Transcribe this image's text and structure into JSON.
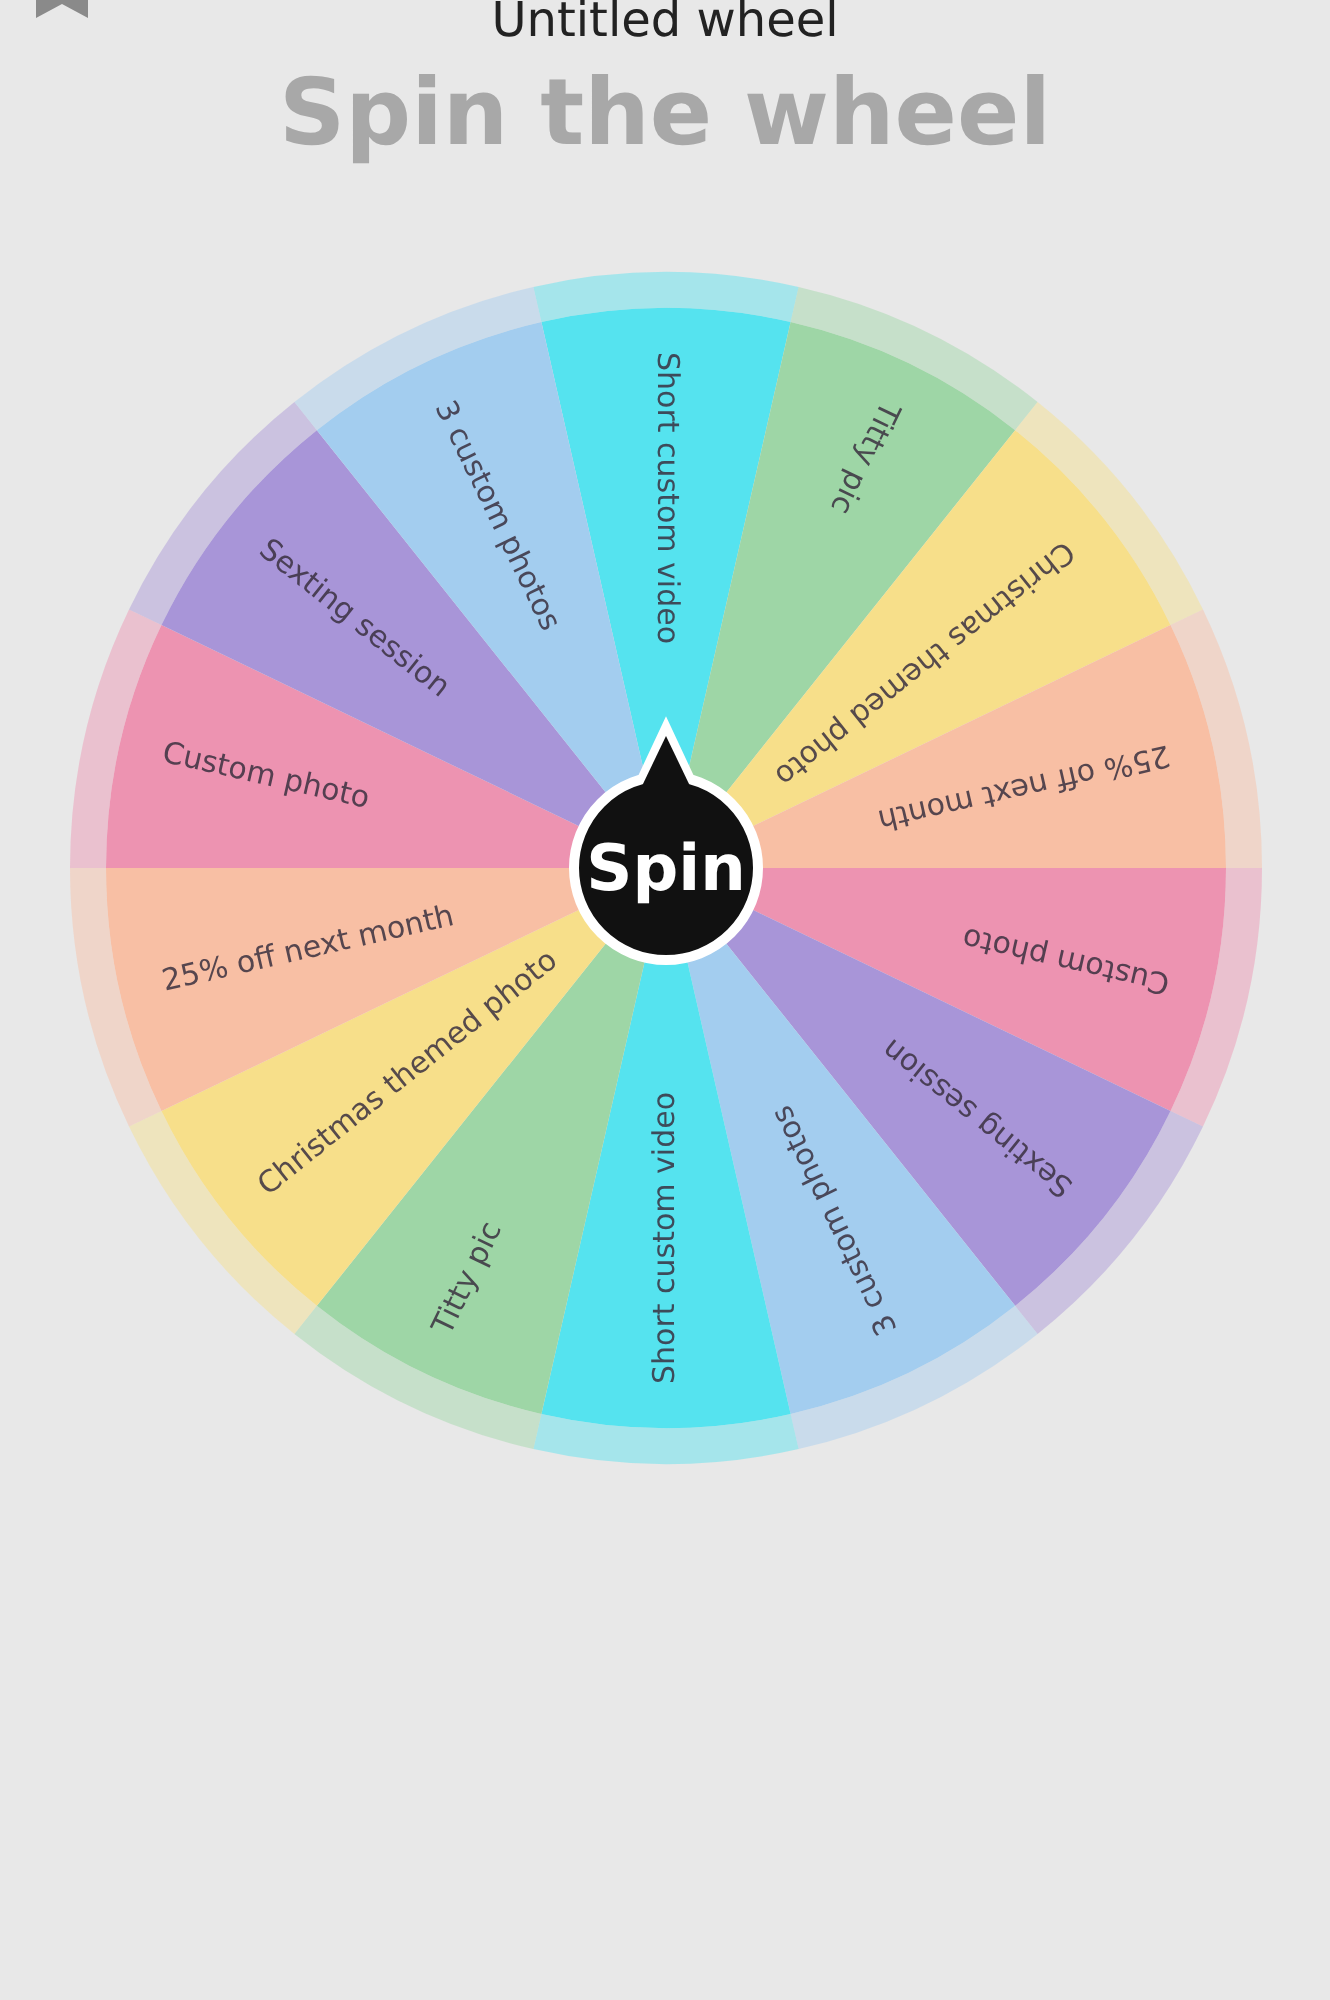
{
  "header": {
    "title": "Untitled wheel"
  },
  "heading": "Spin the wheel",
  "wheel": {
    "spin_button": "Spin",
    "segments": [
      {
        "label": "Short custom video",
        "color": "#55e3ef"
      },
      {
        "label": "Titty pic",
        "color": "#9ed6a6"
      },
      {
        "label": "Christmas themed photo",
        "color": "#f7df8a"
      },
      {
        "label": "25% off next month",
        "color": "#f8bfa4"
      },
      {
        "label": "Custom photo",
        "color": "#ed93b1"
      },
      {
        "label": "Sexting session",
        "color": "#a895d8"
      },
      {
        "label": "3 custom photos",
        "color": "#a3cdef"
      },
      {
        "label": "Short custom video",
        "color": "#55e3ef"
      },
      {
        "label": "Titty pic",
        "color": "#9ed6a6"
      },
      {
        "label": "Christmas themed photo",
        "color": "#f7df8a"
      },
      {
        "label": "25% off next month",
        "color": "#f8bfa4"
      },
      {
        "label": "Custom photo",
        "color": "#ed93b1"
      },
      {
        "label": "Sexting session",
        "color": "#a895d8"
      },
      {
        "label": "3 custom photos",
        "color": "#a3cdef"
      }
    ]
  }
}
